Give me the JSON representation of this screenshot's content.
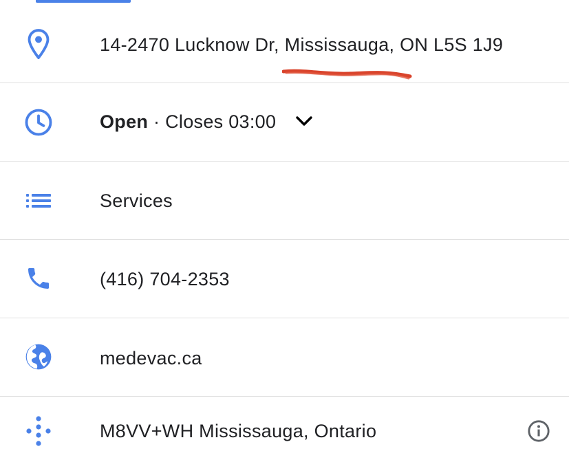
{
  "address": {
    "icon": "location-pin-icon",
    "text": "14-2470 Lucknow Dr, Mississauga, ON L5S 1J9"
  },
  "hours": {
    "icon": "clock-icon",
    "status": "Open",
    "separator": " · ",
    "closes": "Closes 03:00",
    "expand_icon": "chevron-down-icon"
  },
  "services": {
    "icon": "list-icon",
    "text": "Services"
  },
  "phone": {
    "icon": "phone-icon",
    "text": "(416) 704-2353"
  },
  "website": {
    "icon": "globe-icon",
    "text": "medevac.ca"
  },
  "plus_code": {
    "icon": "plus-code-icon",
    "text": "M8VV+WH Mississauga, Ontario",
    "info_icon": "info-icon"
  },
  "colors": {
    "icon_blue": "#4a81e8",
    "annotation_red": "#d9432b",
    "divider": "#e0e0e0",
    "text": "#202124"
  }
}
